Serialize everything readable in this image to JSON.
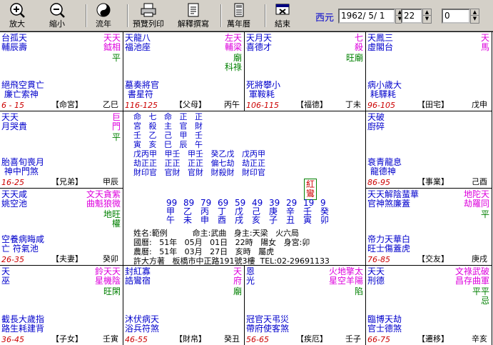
{
  "toolbar": {
    "buttons": [
      {
        "id": "zoom-in",
        "label": "放大",
        "icon": "zoom-in-icon"
      },
      {
        "id": "zoom-out",
        "label": "縮小",
        "icon": "zoom-out-icon"
      },
      {
        "id": "flow",
        "label": "流年",
        "icon": "taiji-icon"
      },
      {
        "id": "preview",
        "label": "預覽列印",
        "icon": "printer-icon"
      },
      {
        "id": "explain",
        "label": "解釋撰寫",
        "icon": "edit-document-icon"
      },
      {
        "id": "calendar",
        "label": "萬年曆",
        "icon": "calendar-icon"
      },
      {
        "id": "exit",
        "label": "結束",
        "icon": "exit-icon"
      }
    ],
    "era_label": "西元",
    "date_value": "1962/ 5/ 1",
    "hour_value": "22",
    "minute_value": "0"
  },
  "palaces": [
    {
      "id": "ming",
      "top_left": "台孤天\n輔辰壽",
      "top_right": "天天\n鉞相",
      "note": "平",
      "bottom": "絕飛空貫亡\n 廉亡索神",
      "age": "6 - 15",
      "name": "【命宮】",
      "stem": "乙巳"
    },
    {
      "id": "fumu",
      "top_left": "天龍八\n福池座",
      "top_right": "左天\n輔梁",
      "note": "廟\n科祿",
      "bottom": "墓奏將官\n 書星符",
      "age": "116-125",
      "name": "【父母】",
      "stem": "丙午"
    },
    {
      "id": "fude",
      "top_left": "天月天\n喜德才",
      "top_right": "七\n殺",
      "note": "旺廟",
      "bottom": "死將攀小\n 軍鞍耗",
      "age": "106-115",
      "name": "【福德】",
      "stem": "丁未"
    },
    {
      "id": "tianzhai",
      "top_left": "天鳳三\n虛閣台",
      "top_right": "天\n馬",
      "note": "",
      "bottom": "病小歲大\n 耗驛耗",
      "age": "96-105",
      "name": "【田宅】",
      "stem": "戊申"
    },
    {
      "id": "xiongdi",
      "top_left": "天天\n月哭貴",
      "top_right": "巨\n門",
      "note": "平",
      "bottom": "胎喜旬喪月\n 神中門煞",
      "age": "16-25",
      "name": "【兄弟】",
      "stem": "甲辰"
    },
    {
      "id": "shiye",
      "top_left": "天破\n廚碎",
      "top_right": "",
      "note": "",
      "bottom": "衰青龍息\n 龍德神",
      "age": "86-95",
      "name": "【事業】",
      "stem": "己酉"
    },
    {
      "id": "fuqi",
      "top_left": "天天咸\n姚空池",
      "top_right": "文天貪紫\n曲魁狼微",
      "note": "地旺\n權",
      "bottom": "空養病晦咸\n亡 符氣池",
      "age": "26-35",
      "name": "【夫妻】",
      "stem": "癸卯"
    },
    {
      "id": "jiaoyou",
      "top_left": "天天解陰蜚華\n官神煞廉蓋",
      "top_right": "地陀天\n劫羅同",
      "note": "平",
      "bottom": "帝力天華白\n旺士傷蓋虎",
      "age": "76-85",
      "name": "【交友】",
      "stem": "庚戌"
    },
    {
      "id": "zinu",
      "top_left": "天\n巫",
      "top_right": "鈴天天\n星機陰",
      "note": "旺閑",
      "bottom": "截長大歲指\n路生耗建背",
      "age": "36-45",
      "name": "【子女】",
      "stem": "壬寅"
    },
    {
      "id": "caibo",
      "top_left": "封紅寡\n誥鸞宿",
      "top_right": "天\n府",
      "note": "廟",
      "bottom": "沐伏病天\n浴兵符煞",
      "age": "46-55",
      "name": "【財帛】",
      "stem": "癸丑"
    },
    {
      "id": "jie",
      "top_left": "恩\n光",
      "top_right": "火地擎太\n星空羊陽",
      "note": "陷",
      "bottom": "冠官天弔災\n帶府使客煞",
      "age": "56-65",
      "name": "【疾厄】",
      "stem": "壬子"
    },
    {
      "id": "qianyi",
      "top_left": "天天\n刑德",
      "top_right": "文祿武破\n昌存曲軍",
      "note": "平平\n忌",
      "bottom": "臨博天劫\n官士德煞",
      "age": "66-75",
      "name": "【遷移】",
      "stem": "辛亥"
    }
  ],
  "center": {
    "table_rows": [
      "命   七   命   正   正",
      "宮   殺   主   官   財",
      "壬   乙   己   甲   壬",
      "寅   亥   巳   辰   午",
      "戊丙甲   甲壬   甲壬   癸乙戊   戊丙甲",
      "劫正正   正正   正正   偏七劫   劫正正",
      "財印官   官財   官財   財殺財   財印官"
    ],
    "luck_ages": [
      "99",
      "89",
      "79",
      "69",
      "59",
      "49",
      "39",
      "29",
      "19",
      "9"
    ],
    "luck_stems": [
      "甲",
      "乙",
      "丙",
      "丁",
      "戊",
      "己",
      "庚",
      "辛",
      "壬",
      "癸"
    ],
    "luck_branches": [
      "午",
      "未",
      "申",
      "酉",
      "戌",
      "亥",
      "子",
      "丑",
      "寅",
      "卯"
    ],
    "red_box": "紅\n鸞",
    "info": [
      "姓名:範例          命主:武曲   身主:天梁   火六局",
      "國曆:   51年   05月   01日   22時   陽女   身宮:卯",
      "農曆:   51年   03月   27日   亥時   屬虎",
      "許大方著   板橋市中正路191號3樓  TEL:02-29691133"
    ]
  }
}
